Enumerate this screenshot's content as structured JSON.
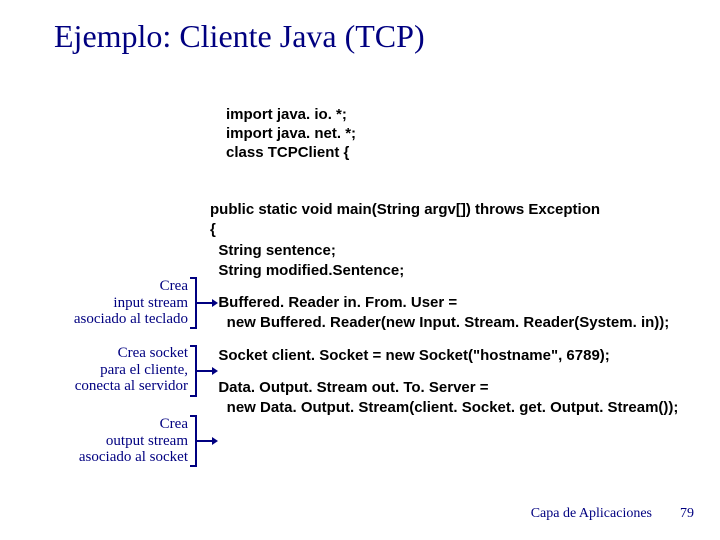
{
  "title": "Ejemplo: Cliente Java (TCP)",
  "code": {
    "top1": "import java. io. *;",
    "top2": "import java. net. *;",
    "top3": "class TCPClient {",
    "m1": "public static void main(String argv[]) throws Exception",
    "m2": "{",
    "m3": "  String sentence;",
    "m4": "  String modified.Sentence;",
    "m5": "  Buffered. Reader in. From. User =",
    "m6": "    new Buffered. Reader(new Input. Stream. Reader(System. in));",
    "m7": "  Socket client. Socket = new Socket(\"hostname\", 6789);",
    "m8": "  Data. Output. Stream out. To. Server =",
    "m9": "    new Data. Output. Stream(client. Socket. get. Output. Stream());"
  },
  "annotations": {
    "a1l1": "Crea",
    "a1l2": "input stream",
    "a1l3": "asociado al teclado",
    "a2l1": "Crea socket",
    "a2l2": "para el cliente,",
    "a2l3": "conecta al servidor",
    "a3l1": "Crea",
    "a3l2": "output stream",
    "a3l3": "asociado al socket"
  },
  "footer": {
    "label": "Capa de Aplicaciones",
    "page": "79"
  }
}
